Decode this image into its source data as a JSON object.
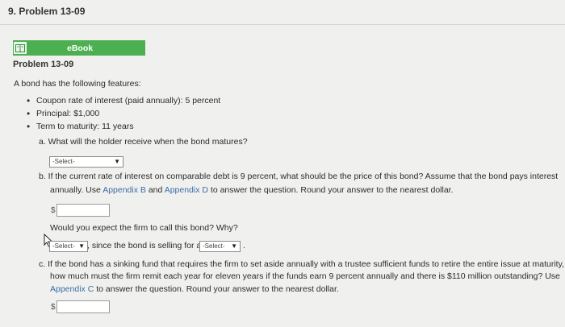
{
  "header": {
    "title": "9.  Problem 13-09"
  },
  "ebook": {
    "label": "eBook",
    "icon": "book-icon"
  },
  "problem": {
    "heading": "Problem 13-09",
    "intro": "A bond has the following features:",
    "features": [
      "Coupon rate of interest (paid annually): 5 percent",
      "Principal: $1,000",
      "Term to maturity: 11 years"
    ]
  },
  "part_a": {
    "question": "a.  What will the holder receive when the bond matures?",
    "select_value": "-Select-"
  },
  "part_b": {
    "question_line1": "b.  If the current rate of interest on comparable debt is 9 percent, what should be the price of this bond? Assume that the bond pays interest",
    "question_line2_pre": "annually. Use ",
    "appendix_b": "Appendix B",
    "and": " and ",
    "appendix_d": "Appendix D",
    "question_line2_post": " to answer the question. Round your answer to the nearest dollar.",
    "dollar": "$",
    "call_question": "Would you expect the firm to call this bond? Why?",
    "select1": "-Select-",
    "mid_text": ", since the bond is selling for a",
    "select2": "-Select-",
    "end": "."
  },
  "part_c": {
    "line1": "c.  If the bond has a sinking fund that requires the firm to set aside annually with a trustee sufficient funds to retire the entire issue at maturity,",
    "line2": "how much must the firm remit each year for eleven years if the funds earn 9 percent annually and there is $110 million outstanding? Use",
    "appendix_c": "Appendix C",
    "line3_post": " to answer the question. Round your answer to the nearest dollar.",
    "dollar": "$"
  }
}
